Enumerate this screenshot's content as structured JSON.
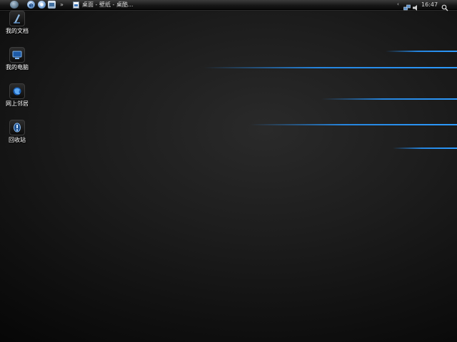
{
  "taskbar": {
    "task_title": "桌面 - 壁纸 - 桌酷...",
    "quicklaunch_arrow": "»",
    "tray_arrow": "‹",
    "clock": "16:47"
  },
  "desktop": {
    "icons": [
      {
        "label": "我的文档",
        "icon": "my-documents-icon"
      },
      {
        "label": "我的电脑",
        "icon": "my-computer-icon"
      },
      {
        "label": "网上邻居",
        "icon": "network-places-icon"
      },
      {
        "label": "回收站",
        "icon": "recycle-bin-icon"
      }
    ]
  },
  "colors": {
    "wallpaper_dark": "#101010",
    "streak_blue": "#2d9bff",
    "taskbar": "#161616"
  }
}
